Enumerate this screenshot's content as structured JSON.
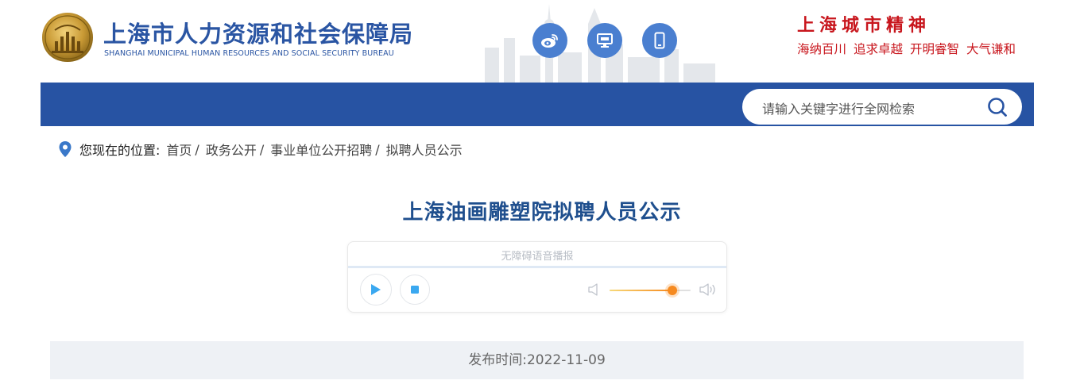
{
  "header": {
    "org_name_cn": "上海市人力资源和社会保障局",
    "org_name_en": "SHANGHAI MUNICIPAL HUMAN RESOURCES AND SOCIAL SECURITY BUREAU",
    "logo_icon": "bureau-emblem-icon",
    "social_buttons": [
      {
        "icon": "weibo-icon"
      },
      {
        "icon": "desktop-icon"
      },
      {
        "icon": "mobile-icon"
      }
    ],
    "spirit_title": "上海城市精神",
    "spirit_phrases": [
      "海纳百川",
      "追求卓越",
      "开明睿智",
      "大气谦和"
    ]
  },
  "search": {
    "placeholder": "请输入关键字进行全网检索",
    "icon": "search-icon"
  },
  "breadcrumb": {
    "lead": "您现在的位置:",
    "items": [
      "首页",
      "政务公开",
      "事业单位公开招聘",
      "拟聘人员公示"
    ]
  },
  "article": {
    "title": "上海油画雕塑院拟聘人员公示",
    "publish_label": "发布时间:",
    "publish_date": "2022-11-09"
  },
  "player": {
    "label": "无障碍语音播报",
    "volume_level": 0.77
  },
  "colors": {
    "brand_blue": "#2753a3",
    "title_blue": "#1f4f8e",
    "spirit_red": "#c8161d",
    "icon_blue": "#4a7fd0",
    "player_accent": "#3aa8f0",
    "volume_orange": "#f68a1f"
  }
}
